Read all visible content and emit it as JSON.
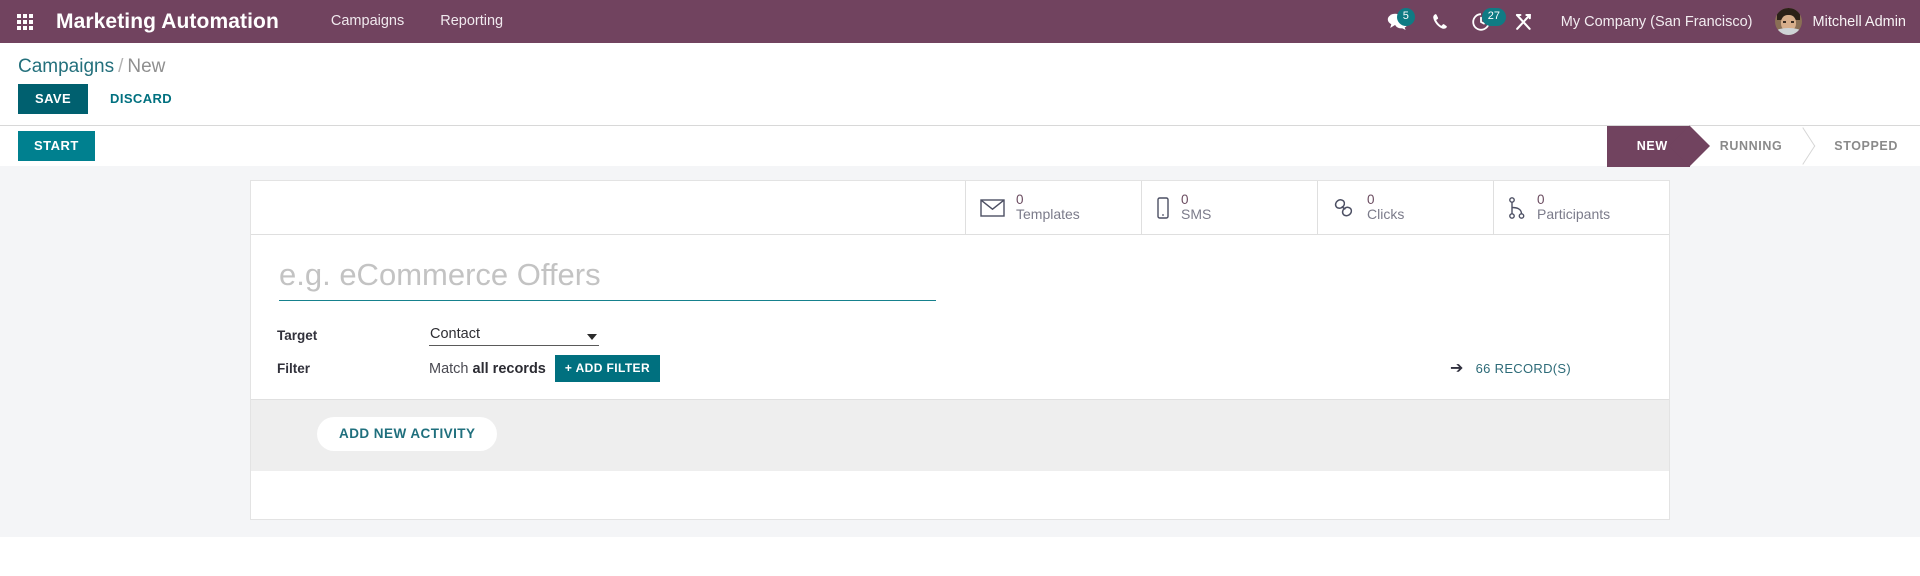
{
  "navbar": {
    "apps_icon": "apps-grid-icon",
    "brand": "Marketing Automation",
    "menu": [
      {
        "label": "Campaigns"
      },
      {
        "label": "Reporting"
      }
    ],
    "systray": [
      {
        "icon": "messages-icon",
        "badge": "5"
      },
      {
        "icon": "phone-icon",
        "badge": ""
      },
      {
        "icon": "activities-clock-icon",
        "badge": "27"
      },
      {
        "icon": "debug-tools-icon",
        "badge": ""
      }
    ],
    "company": "My Company (San Francisco)",
    "user_name": "Mitchell Admin",
    "accent_bg": "#71435f"
  },
  "control_panel": {
    "breadcrumb": {
      "root": "Campaigns",
      "separator": "/",
      "current": "New"
    },
    "save_label": "SAVE",
    "discard_label": "DISCARD",
    "start_label": "START",
    "accent_teal": "#00606f"
  },
  "statusbar": {
    "steps": [
      {
        "label": "NEW",
        "active": true
      },
      {
        "label": "RUNNING",
        "active": false
      },
      {
        "label": "STOPPED",
        "active": false
      }
    ],
    "active_bg": "#71435f"
  },
  "stats": [
    {
      "icon": "envelope-icon",
      "value": "0",
      "label": "Templates"
    },
    {
      "icon": "mobile-icon",
      "value": "0",
      "label": "SMS"
    },
    {
      "icon": "chain-links-icon",
      "value": "0",
      "label": "Clicks"
    },
    {
      "icon": "sitemap-icon",
      "value": "0",
      "label": "Participants"
    }
  ],
  "form": {
    "title_value": "",
    "title_placeholder": "e.g. eCommerce Offers",
    "target": {
      "label": "Target",
      "value": "Contact"
    },
    "filter": {
      "label": "Filter",
      "match_prefix": "Match",
      "match_strong": "all records",
      "add_filter_label": "ADD FILTER",
      "add_filter_plus": "+",
      "records_arrow": "➔",
      "records_count": "66 RECORD(S)"
    },
    "add_activity_label": "ADD NEW ACTIVITY"
  }
}
